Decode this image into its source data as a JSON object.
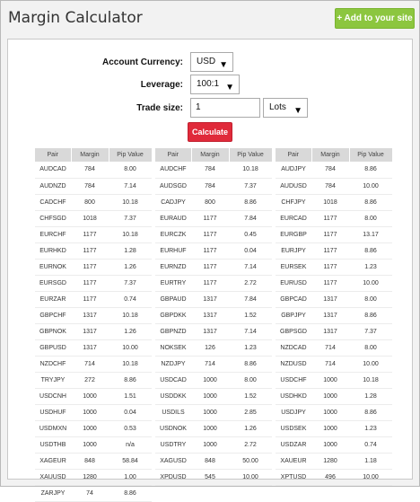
{
  "header": {
    "title": "Margin Calculator",
    "add_button": "+ Add to your site"
  },
  "form": {
    "account_currency_label": "Account Currency:",
    "account_currency_value": "USD",
    "leverage_label": "Leverage:",
    "leverage_value": "100:1",
    "trade_size_label": "Trade size:",
    "trade_size_value": "1",
    "trade_unit_value": "Lots",
    "calculate_label": "Calculate"
  },
  "table_headers": {
    "pair": "Pair",
    "margin": "Margin",
    "pip_value": "Pip Value"
  },
  "tables": [
    {
      "rows": [
        [
          "AUDCAD",
          "784",
          "8.00"
        ],
        [
          "AUDNZD",
          "784",
          "7.14"
        ],
        [
          "CADCHF",
          "800",
          "10.18"
        ],
        [
          "CHFSGD",
          "1018",
          "7.37"
        ],
        [
          "EURCHF",
          "1177",
          "10.18"
        ],
        [
          "EURHKD",
          "1177",
          "1.28"
        ],
        [
          "EURNOK",
          "1177",
          "1.26"
        ],
        [
          "EURSGD",
          "1177",
          "7.37"
        ],
        [
          "EURZAR",
          "1177",
          "0.74"
        ],
        [
          "GBPCHF",
          "1317",
          "10.18"
        ],
        [
          "GBPNOK",
          "1317",
          "1.26"
        ],
        [
          "GBPUSD",
          "1317",
          "10.00"
        ],
        [
          "NZDCHF",
          "714",
          "10.18"
        ],
        [
          "TRYJPY",
          "272",
          "8.86"
        ],
        [
          "USDCNH",
          "1000",
          "1.51"
        ],
        [
          "USDHUF",
          "1000",
          "0.04"
        ],
        [
          "USDMXN",
          "1000",
          "0.53"
        ],
        [
          "USDTHB",
          "1000",
          "n/a"
        ],
        [
          "XAGEUR",
          "848",
          "58.84"
        ],
        [
          "XAUUSD",
          "1280",
          "1.00"
        ],
        [
          "ZARJPY",
          "74",
          "8.86"
        ]
      ]
    },
    {
      "rows": [
        [
          "AUDCHF",
          "784",
          "10.18"
        ],
        [
          "AUDSGD",
          "784",
          "7.37"
        ],
        [
          "CADJPY",
          "800",
          "8.86"
        ],
        [
          "EURAUD",
          "1177",
          "7.84"
        ],
        [
          "EURCZK",
          "1177",
          "0.45"
        ],
        [
          "EURHUF",
          "1177",
          "0.04"
        ],
        [
          "EURNZD",
          "1177",
          "7.14"
        ],
        [
          "EURTRY",
          "1177",
          "2.72"
        ],
        [
          "GBPAUD",
          "1317",
          "7.84"
        ],
        [
          "GBPDKK",
          "1317",
          "1.52"
        ],
        [
          "GBPNZD",
          "1317",
          "7.14"
        ],
        [
          "NOKSEK",
          "126",
          "1.23"
        ],
        [
          "NZDJPY",
          "714",
          "8.86"
        ],
        [
          "USDCAD",
          "1000",
          "8.00"
        ],
        [
          "USDDKK",
          "1000",
          "1.52"
        ],
        [
          "USDILS",
          "1000",
          "2.85"
        ],
        [
          "USDNOK",
          "1000",
          "1.26"
        ],
        [
          "USDTRY",
          "1000",
          "2.72"
        ],
        [
          "XAGUSD",
          "848",
          "50.00"
        ],
        [
          "XPDUSD",
          "545",
          "10.00"
        ]
      ]
    },
    {
      "rows": [
        [
          "AUDJPY",
          "784",
          "8.86"
        ],
        [
          "AUDUSD",
          "784",
          "10.00"
        ],
        [
          "CHFJPY",
          "1018",
          "8.86"
        ],
        [
          "EURCAD",
          "1177",
          "8.00"
        ],
        [
          "EURGBP",
          "1177",
          "13.17"
        ],
        [
          "EURJPY",
          "1177",
          "8.86"
        ],
        [
          "EURSEK",
          "1177",
          "1.23"
        ],
        [
          "EURUSD",
          "1177",
          "10.00"
        ],
        [
          "GBPCAD",
          "1317",
          "8.00"
        ],
        [
          "GBPJPY",
          "1317",
          "8.86"
        ],
        [
          "GBPSGD",
          "1317",
          "7.37"
        ],
        [
          "NZDCAD",
          "714",
          "8.00"
        ],
        [
          "NZDUSD",
          "714",
          "10.00"
        ],
        [
          "USDCHF",
          "1000",
          "10.18"
        ],
        [
          "USDHKD",
          "1000",
          "1.28"
        ],
        [
          "USDJPY",
          "1000",
          "8.86"
        ],
        [
          "USDSEK",
          "1000",
          "1.23"
        ],
        [
          "USDZAR",
          "1000",
          "0.74"
        ],
        [
          "XAUEUR",
          "1280",
          "1.18"
        ],
        [
          "XPTUSD",
          "496",
          "10.00"
        ]
      ]
    }
  ]
}
